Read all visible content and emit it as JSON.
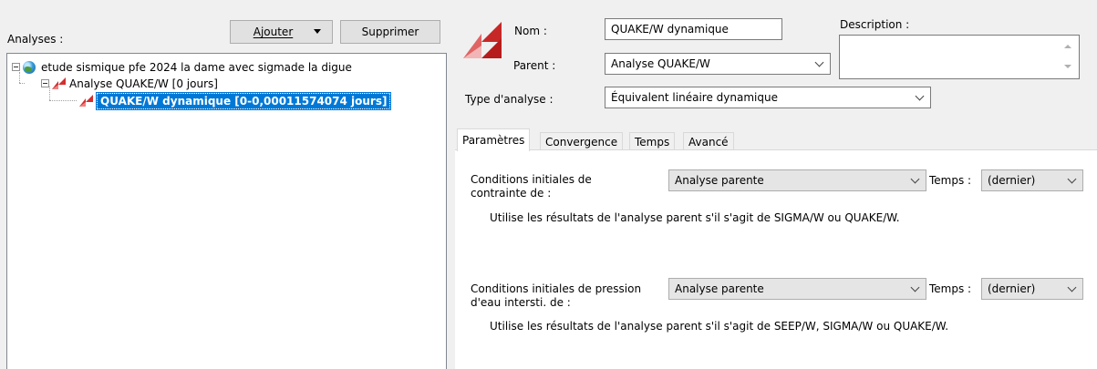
{
  "left": {
    "analyses_label": "Analyses :",
    "add_label": "Ajouter",
    "delete_label": "Supprimer",
    "tree": [
      {
        "label": "etude sismique pfe 2024 la dame avec sigmade la digue",
        "icon": "globe-icon"
      },
      {
        "label": "Analyse QUAKE/W [0 jours]",
        "icon": "quake-icon"
      },
      {
        "label": "QUAKE/W dynamique [0-0,00011574074 jours]",
        "icon": "quake-icon",
        "selected": true
      }
    ]
  },
  "form": {
    "nom_label": "Nom :",
    "nom_value": "QUAKE/W dynamique",
    "description_label": "Description :",
    "description_value": "",
    "parent_label": "Parent :",
    "parent_value": "Analyse QUAKE/W",
    "type_label": "Type d'analyse :",
    "type_value": "Équivalent linéaire dynamique"
  },
  "tabs": [
    "Paramètres",
    "Convergence",
    "Temps",
    "Avancé"
  ],
  "params": {
    "stress_label_1": "Conditions initiales de",
    "stress_label_2": "contrainte de :",
    "stress_value": "Analyse parente",
    "time_label": "Temps :",
    "stress_time_value": "(dernier)",
    "stress_note": "Utilise les résultats de l'analyse parent s'il s'agit de SIGMA/W ou QUAKE/W.",
    "pore_label_1": "Conditions initiales de pression",
    "pore_label_2": "d'eau intersti. de :",
    "pore_value": "Analyse parente",
    "pore_time_value": "(dernier)",
    "pore_note": "Utilise les résultats de l'analyse parent s'il s'agit de SEEP/W, SIGMA/W ou QUAKE/W."
  },
  "colors": {
    "selection": "#0078d7",
    "quake_icon": "#d32f2f"
  }
}
